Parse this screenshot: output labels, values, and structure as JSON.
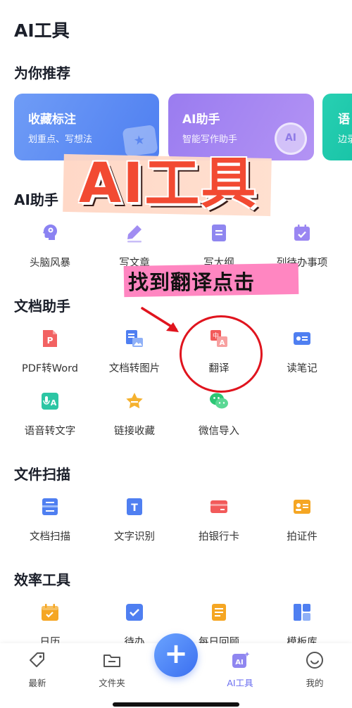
{
  "header": {
    "title": "AI工具"
  },
  "recommend": {
    "title": "为你推荐",
    "cards": [
      {
        "title": "收藏标注",
        "subtitle": "划重点、写想法"
      },
      {
        "title": "AI助手",
        "subtitle": "智能写作助手",
        "badge": "AI"
      },
      {
        "title": "语",
        "subtitle": "边录"
      }
    ]
  },
  "sections": {
    "ai": {
      "title": "AI助手",
      "items": [
        {
          "label": "头脑风暴",
          "icon": "brain-icon"
        },
        {
          "label": "写文章",
          "icon": "pen-icon"
        },
        {
          "label": "写大纲",
          "icon": "outline-icon"
        },
        {
          "label": "列待办事项",
          "icon": "todo-icon"
        }
      ]
    },
    "doc": {
      "title": "文档助手",
      "items": [
        {
          "label": "PDF转Word",
          "icon": "pdf-icon"
        },
        {
          "label": "文档转图片",
          "icon": "doc-image-icon"
        },
        {
          "label": "翻译",
          "icon": "translate-icon"
        },
        {
          "label": "读笔记",
          "icon": "read-note-icon"
        },
        {
          "label": "语音转文字",
          "icon": "voice-text-icon"
        },
        {
          "label": "链接收藏",
          "icon": "star-icon"
        },
        {
          "label": "微信导入",
          "icon": "wechat-icon"
        }
      ]
    },
    "scan": {
      "title": "文件扫描",
      "items": [
        {
          "label": "文档扫描",
          "icon": "scan-doc-icon"
        },
        {
          "label": "文字识别",
          "icon": "ocr-icon"
        },
        {
          "label": "拍银行卡",
          "icon": "bank-card-icon"
        },
        {
          "label": "拍证件",
          "icon": "id-card-icon"
        }
      ]
    },
    "efficiency": {
      "title": "效率工具",
      "items": [
        {
          "label": "日历",
          "icon": "calendar-icon"
        },
        {
          "label": "待办",
          "icon": "checkbox-icon"
        },
        {
          "label": "每日回顾",
          "icon": "review-icon"
        },
        {
          "label": "模板库",
          "icon": "template-icon"
        }
      ]
    }
  },
  "overlay": {
    "banner": "AI工具",
    "hint": "找到翻译点击"
  },
  "nav": {
    "items": [
      {
        "label": "最新",
        "icon": "tag-icon"
      },
      {
        "label": "文件夹",
        "icon": "folder-icon"
      },
      {
        "label": "AI工具",
        "icon": "ai-tools-icon",
        "active": true
      },
      {
        "label": "我的",
        "icon": "profile-icon"
      }
    ],
    "fab": "+"
  },
  "colors": {
    "accent": "#4f7ff1",
    "ai_purple": "#9a7cf0",
    "translate_red": "#f25a5a",
    "highlight_red": "#e0141e",
    "hint_pink": "#ff86c1"
  }
}
